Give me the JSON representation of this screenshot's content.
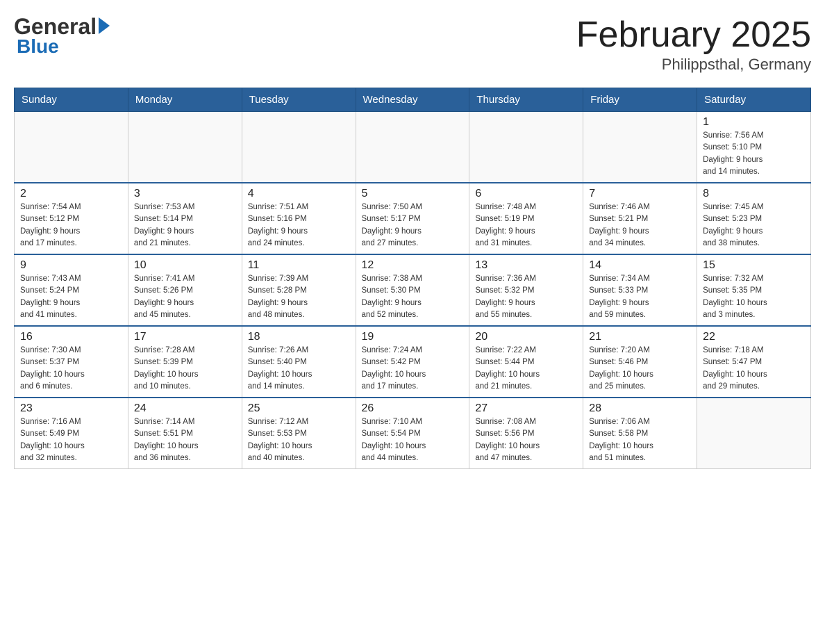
{
  "header": {
    "logo_general": "General",
    "logo_blue": "Blue",
    "title": "February 2025",
    "subtitle": "Philippsthal, Germany"
  },
  "days_of_week": [
    "Sunday",
    "Monday",
    "Tuesday",
    "Wednesday",
    "Thursday",
    "Friday",
    "Saturday"
  ],
  "weeks": [
    [
      {
        "day": "",
        "info": ""
      },
      {
        "day": "",
        "info": ""
      },
      {
        "day": "",
        "info": ""
      },
      {
        "day": "",
        "info": ""
      },
      {
        "day": "",
        "info": ""
      },
      {
        "day": "",
        "info": ""
      },
      {
        "day": "1",
        "info": "Sunrise: 7:56 AM\nSunset: 5:10 PM\nDaylight: 9 hours\nand 14 minutes."
      }
    ],
    [
      {
        "day": "2",
        "info": "Sunrise: 7:54 AM\nSunset: 5:12 PM\nDaylight: 9 hours\nand 17 minutes."
      },
      {
        "day": "3",
        "info": "Sunrise: 7:53 AM\nSunset: 5:14 PM\nDaylight: 9 hours\nand 21 minutes."
      },
      {
        "day": "4",
        "info": "Sunrise: 7:51 AM\nSunset: 5:16 PM\nDaylight: 9 hours\nand 24 minutes."
      },
      {
        "day": "5",
        "info": "Sunrise: 7:50 AM\nSunset: 5:17 PM\nDaylight: 9 hours\nand 27 minutes."
      },
      {
        "day": "6",
        "info": "Sunrise: 7:48 AM\nSunset: 5:19 PM\nDaylight: 9 hours\nand 31 minutes."
      },
      {
        "day": "7",
        "info": "Sunrise: 7:46 AM\nSunset: 5:21 PM\nDaylight: 9 hours\nand 34 minutes."
      },
      {
        "day": "8",
        "info": "Sunrise: 7:45 AM\nSunset: 5:23 PM\nDaylight: 9 hours\nand 38 minutes."
      }
    ],
    [
      {
        "day": "9",
        "info": "Sunrise: 7:43 AM\nSunset: 5:24 PM\nDaylight: 9 hours\nand 41 minutes."
      },
      {
        "day": "10",
        "info": "Sunrise: 7:41 AM\nSunset: 5:26 PM\nDaylight: 9 hours\nand 45 minutes."
      },
      {
        "day": "11",
        "info": "Sunrise: 7:39 AM\nSunset: 5:28 PM\nDaylight: 9 hours\nand 48 minutes."
      },
      {
        "day": "12",
        "info": "Sunrise: 7:38 AM\nSunset: 5:30 PM\nDaylight: 9 hours\nand 52 minutes."
      },
      {
        "day": "13",
        "info": "Sunrise: 7:36 AM\nSunset: 5:32 PM\nDaylight: 9 hours\nand 55 minutes."
      },
      {
        "day": "14",
        "info": "Sunrise: 7:34 AM\nSunset: 5:33 PM\nDaylight: 9 hours\nand 59 minutes."
      },
      {
        "day": "15",
        "info": "Sunrise: 7:32 AM\nSunset: 5:35 PM\nDaylight: 10 hours\nand 3 minutes."
      }
    ],
    [
      {
        "day": "16",
        "info": "Sunrise: 7:30 AM\nSunset: 5:37 PM\nDaylight: 10 hours\nand 6 minutes."
      },
      {
        "day": "17",
        "info": "Sunrise: 7:28 AM\nSunset: 5:39 PM\nDaylight: 10 hours\nand 10 minutes."
      },
      {
        "day": "18",
        "info": "Sunrise: 7:26 AM\nSunset: 5:40 PM\nDaylight: 10 hours\nand 14 minutes."
      },
      {
        "day": "19",
        "info": "Sunrise: 7:24 AM\nSunset: 5:42 PM\nDaylight: 10 hours\nand 17 minutes."
      },
      {
        "day": "20",
        "info": "Sunrise: 7:22 AM\nSunset: 5:44 PM\nDaylight: 10 hours\nand 21 minutes."
      },
      {
        "day": "21",
        "info": "Sunrise: 7:20 AM\nSunset: 5:46 PM\nDaylight: 10 hours\nand 25 minutes."
      },
      {
        "day": "22",
        "info": "Sunrise: 7:18 AM\nSunset: 5:47 PM\nDaylight: 10 hours\nand 29 minutes."
      }
    ],
    [
      {
        "day": "23",
        "info": "Sunrise: 7:16 AM\nSunset: 5:49 PM\nDaylight: 10 hours\nand 32 minutes."
      },
      {
        "day": "24",
        "info": "Sunrise: 7:14 AM\nSunset: 5:51 PM\nDaylight: 10 hours\nand 36 minutes."
      },
      {
        "day": "25",
        "info": "Sunrise: 7:12 AM\nSunset: 5:53 PM\nDaylight: 10 hours\nand 40 minutes."
      },
      {
        "day": "26",
        "info": "Sunrise: 7:10 AM\nSunset: 5:54 PM\nDaylight: 10 hours\nand 44 minutes."
      },
      {
        "day": "27",
        "info": "Sunrise: 7:08 AM\nSunset: 5:56 PM\nDaylight: 10 hours\nand 47 minutes."
      },
      {
        "day": "28",
        "info": "Sunrise: 7:06 AM\nSunset: 5:58 PM\nDaylight: 10 hours\nand 51 minutes."
      },
      {
        "day": "",
        "info": ""
      }
    ]
  ]
}
